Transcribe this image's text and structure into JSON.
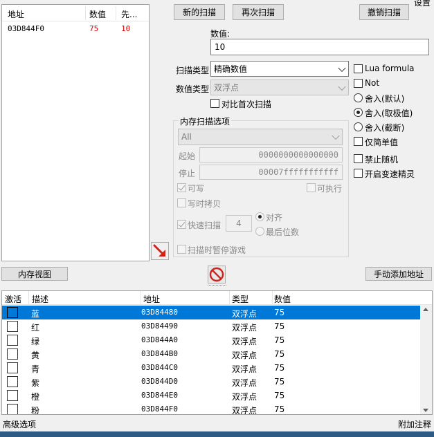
{
  "top_label": "设置",
  "found_list": {
    "columns": [
      "地址",
      "数值",
      "先..."
    ],
    "rows": [
      {
        "address": "03D844F0",
        "value": "75",
        "previous": "10"
      }
    ]
  },
  "buttons": {
    "new_scan": "新的扫描",
    "next_scan": "再次扫描",
    "undo_scan": "撤销扫描",
    "memory_view": "内存视图",
    "add_address": "手动添加地址"
  },
  "value": {
    "label": "数值:",
    "input": "10"
  },
  "scan_type": {
    "label": "扫描类型",
    "selected": "精确数值"
  },
  "value_type": {
    "label": "数值类型",
    "selected": "双浮点"
  },
  "compare_first": "对比首次扫描",
  "right_options": {
    "lua_formula": "Lua formula",
    "not": "Not",
    "round_default": "舍入(默认)",
    "round_extreme": "舍入(取极值)",
    "round_truncate": "舍入(截断)",
    "simple_value": "仅简单值",
    "no_random": "禁止随机",
    "speedhack": "开启变速精灵"
  },
  "mem_options": {
    "title": "内存扫描选项",
    "region": "All",
    "start_label": "起始",
    "start_value": "0000000000000000",
    "stop_label": "停止",
    "stop_value": "00007fffffffffff",
    "writable": "可写",
    "executable": "可执行",
    "copy_on_write": "写时拷贝",
    "fast_scan": "快速扫描",
    "fast_scan_value": "4",
    "alignment": "对齐",
    "last_digits": "最后位数",
    "pause_game": "扫描时暂停游戏"
  },
  "table": {
    "columns": [
      "激活",
      "描述",
      "地址",
      "类型",
      "数值"
    ],
    "rows": [
      {
        "desc": "蓝",
        "address": "03D84480",
        "type": "双浮点",
        "value": "75"
      },
      {
        "desc": "红",
        "address": "03D84490",
        "type": "双浮点",
        "value": "75"
      },
      {
        "desc": "绿",
        "address": "03D844A0",
        "type": "双浮点",
        "value": "75"
      },
      {
        "desc": "黄",
        "address": "03D844B0",
        "type": "双浮点",
        "value": "75"
      },
      {
        "desc": "青",
        "address": "03D844C0",
        "type": "双浮点",
        "value": "75"
      },
      {
        "desc": "紫",
        "address": "03D844D0",
        "type": "双浮点",
        "value": "75"
      },
      {
        "desc": "橙",
        "address": "03D844E0",
        "type": "双浮点",
        "value": "75"
      },
      {
        "desc": "粉",
        "address": "03D844F0",
        "type": "双浮点",
        "value": "75"
      }
    ]
  },
  "status": {
    "left": "高级选项",
    "right": "附加注释"
  },
  "colors": {
    "selection": "#0078d7",
    "found_value": "#d40000",
    "arrow_red": "#d0221b",
    "stop_red": "#d0221b"
  },
  "icons": {
    "pointer_arrow": "arrow-down-right-icon",
    "stop": "no-entry-icon"
  }
}
